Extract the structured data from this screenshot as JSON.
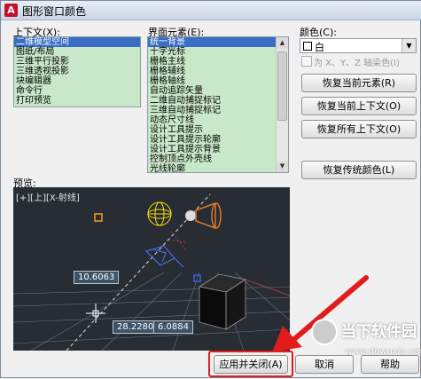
{
  "window": {
    "title": "图形窗口颜色",
    "app_icon": "A"
  },
  "context": {
    "label": "上下文(X):",
    "items": [
      "二维模型空间",
      "图纸/布局",
      "三维平行投影",
      "三维透视投影",
      "块编辑器",
      "命令行",
      "打印预览"
    ],
    "selected_index": 0
  },
  "elements": {
    "label": "界面元素(E):",
    "items": [
      "统一背景",
      "十字光标",
      "栅格主线",
      "栅格辅线",
      "栅格轴线",
      "自动追踪矢量",
      "二维自动捕捉标记",
      "三维自动捕捉标记",
      "动态尺寸线",
      "设计工具提示",
      "设计工具提示轮廓",
      "设计工具提示背景",
      "控制顶点外壳线",
      "光线轮廓"
    ],
    "selected_index": 0
  },
  "color": {
    "label": "颜色(C):",
    "value": "白",
    "swatch": "#ffffff",
    "tint_checkbox": "为 X、Y、Z 轴染色(I)"
  },
  "buttons": {
    "restore_element": "恢复当前元素(R)",
    "restore_context": "恢复当前上下文(O)",
    "restore_all": "恢复所有上下文(O)",
    "restore_classic": "恢复传统颜色(L)",
    "apply_close": "应用并关闭(A)",
    "cancel": "取消",
    "help": "帮助"
  },
  "preview": {
    "label": "预览:",
    "viewport_label": "[+][上][X-射线]",
    "tooltip_1": "10.6063",
    "tooltip_2": "28.2280",
    "tooltip_3": "6.0884"
  },
  "watermark": {
    "text": "当下软件园",
    "url": "www.downxia.com"
  },
  "colors": {
    "list_bg": "#c9e7c9",
    "selection": "#3a6ec4",
    "highlight": "#e21b1b",
    "preview_bg": "#282c33"
  }
}
